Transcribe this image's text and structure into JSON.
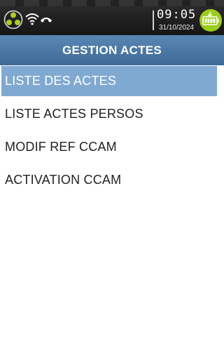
{
  "status_bar": {
    "time": "09:05",
    "date": "31/10/2024",
    "icons": [
      "network-icon",
      "wifi-icon",
      "phone-hangup-icon",
      "battery-charging-icon"
    ]
  },
  "header": {
    "title": "GESTION ACTES"
  },
  "menu": {
    "items": [
      {
        "label": "LISTE DES ACTES",
        "selected": true
      },
      {
        "label": "LISTE ACTES PERSOS",
        "selected": false
      },
      {
        "label": "MODIF REF CCAM",
        "selected": false
      },
      {
        "label": "ACTIVATION CCAM",
        "selected": false
      }
    ]
  },
  "colors": {
    "title_bar": "#4a76a3",
    "selected_item": "#80a9d2",
    "battery": "#9ccc1a"
  }
}
